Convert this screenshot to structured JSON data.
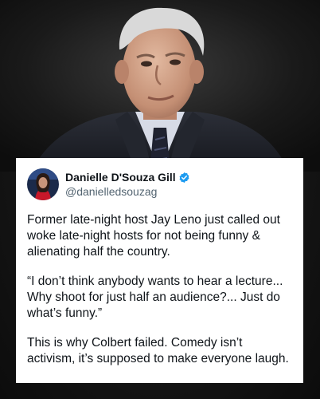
{
  "post": {
    "author": {
      "display_name": "Danielle D'Souza Gill",
      "handle": "@danielledsouzag",
      "verified": true,
      "verified_badge_icon": "verified-badge-icon",
      "verified_color": "#1d9bf0"
    },
    "paragraphs": [
      "Former late-night host Jay Leno just called out woke late-night hosts for not being funny & alienating half the country.",
      "“I don’t think anybody wants to hear a lecture... Why shoot for just half an audience?... Just do what’s funny.”",
      "This is why Colbert failed. Comedy isn’t activism, it’s supposed to make everyone laugh."
    ]
  },
  "colors": {
    "card_background": "#ffffff",
    "text_primary": "#0f1419",
    "text_secondary": "#536471",
    "page_background": "#141414"
  }
}
